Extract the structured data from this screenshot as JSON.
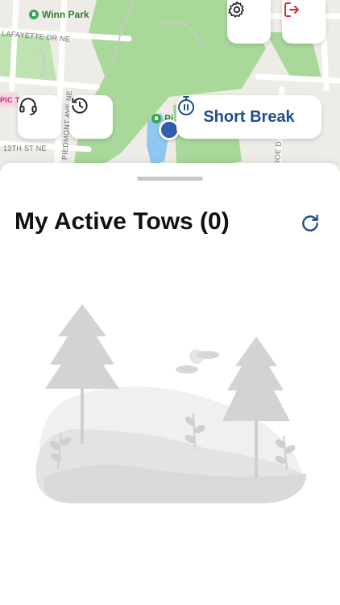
{
  "map": {
    "street_labels": [
      "LAFAYETTE DR NE",
      "13TH ST NE",
      "PIEDMONT AVE NE",
      "ROE D",
      "PIC T"
    ],
    "park_labels": [
      "Winn Park",
      "Pi"
    ],
    "colors": {
      "park": "#a8d89a",
      "road": "#ffffff",
      "water": "#8ec8f0",
      "base": "#eeece6"
    }
  },
  "top_controls": {
    "settings_icon": "gear-icon",
    "logout_icon": "logout-icon",
    "support_icon": "headset-icon",
    "history_icon": "history-icon"
  },
  "break_button": {
    "label": "Short Break",
    "icon": "stopwatch-icon",
    "color": "#1f4e8c"
  },
  "sheet": {
    "title": "My Active Tows (0)",
    "refresh_icon": "refresh-icon"
  },
  "colors": {
    "accent": "#1f4e8c",
    "logout": "#d32f2f"
  }
}
